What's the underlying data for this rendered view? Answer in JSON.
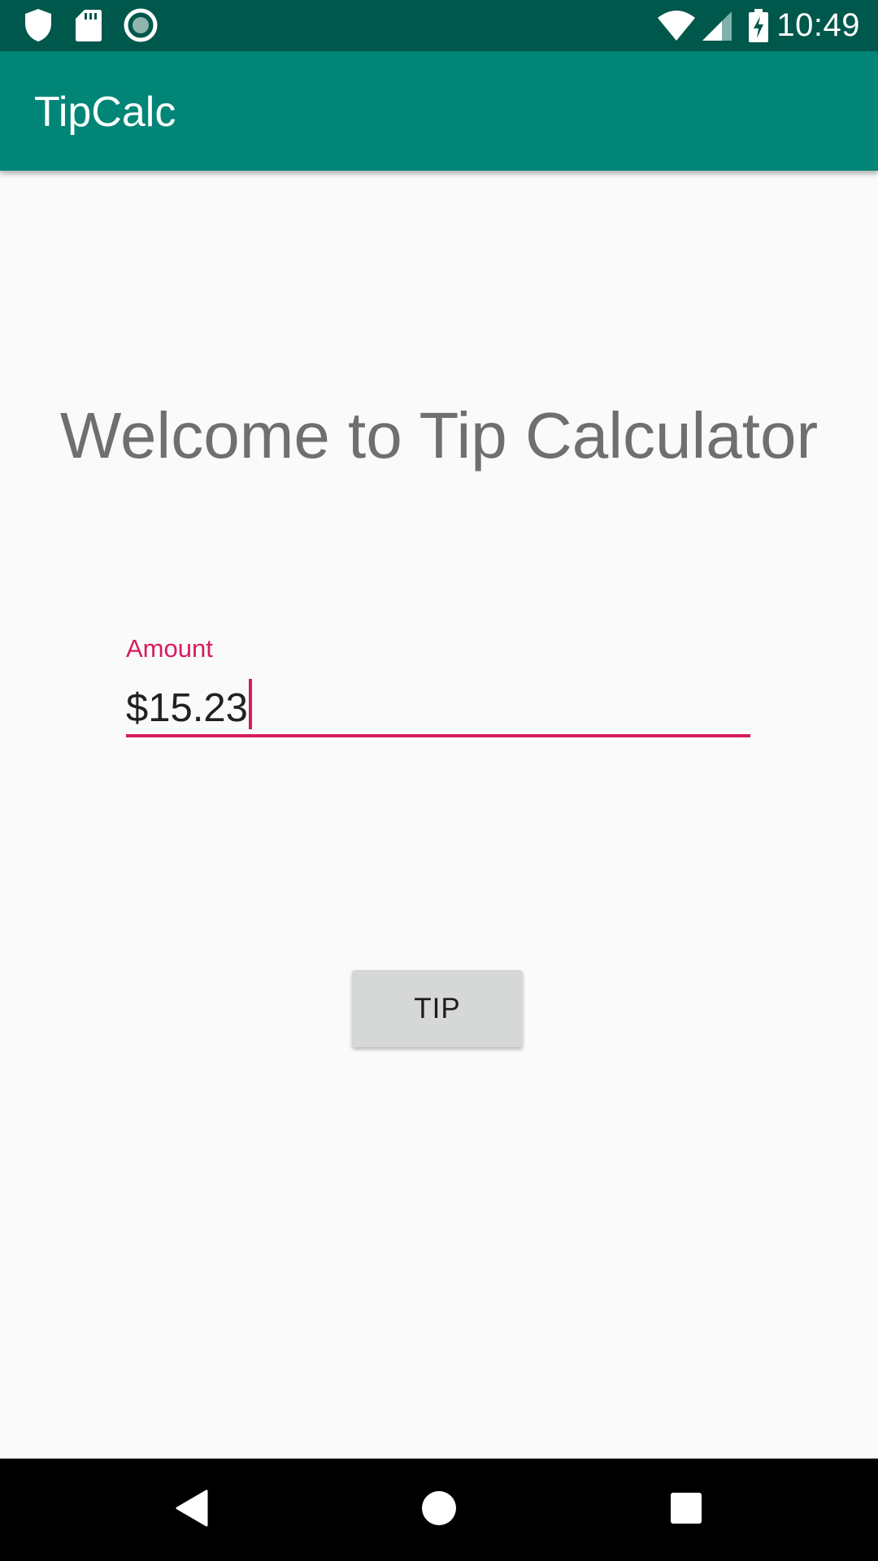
{
  "status_bar": {
    "time": "10:49",
    "left_icons": [
      "shield-icon",
      "sd-card-icon",
      "circle-record-icon"
    ],
    "right_icons": [
      "wifi-icon",
      "signal-icon",
      "battery-charging-icon"
    ],
    "background": "#00574b"
  },
  "app_bar": {
    "title": "TipCalc",
    "background": "#008577"
  },
  "main": {
    "welcome_text": "Welcome to Tip Calculator",
    "amount_field": {
      "label": "Amount",
      "value": "$15.23",
      "accent": "#d81b60"
    },
    "tip_button_label": "TIP"
  },
  "nav_bar": {
    "buttons": [
      "back-icon",
      "home-icon",
      "recents-icon"
    ]
  }
}
